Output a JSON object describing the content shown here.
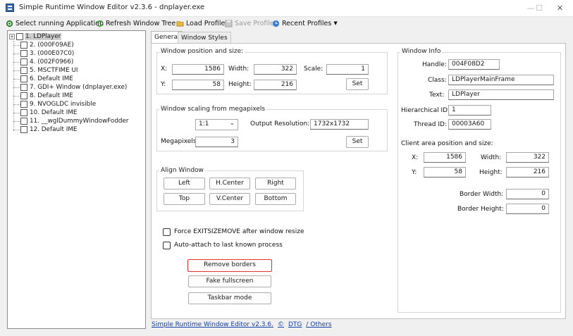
{
  "window": {
    "title": "Simple Runtime Window Editor v2.3.6 - dnplayer.exe",
    "minimize": "—",
    "maximize": "☐",
    "close": "✕"
  },
  "toolbar": {
    "select_app": "Select running Application",
    "refresh": "Refresh Window Tree",
    "load_profile": "Load Profile",
    "save_profile": "Save Profile",
    "recent_profiles": "Recent Profiles"
  },
  "tree": {
    "expander": "+",
    "items": [
      {
        "label": "1. LDPlayer",
        "selected": true
      },
      {
        "label": "2. (000F09AE)"
      },
      {
        "label": "3. (000E07C0)"
      },
      {
        "label": "4. (002F0966)"
      },
      {
        "label": "5. MSCTFIME UI"
      },
      {
        "label": "6. Default IME"
      },
      {
        "label": "7. GDI+ Window (dnplayer.exe)"
      },
      {
        "label": "8. Default IME"
      },
      {
        "label": "9. NVOGLDC invisible"
      },
      {
        "label": "10. Default IME"
      },
      {
        "label": "11. __wglDummyWindowFodder"
      },
      {
        "label": "12. Default IME"
      }
    ]
  },
  "tabs": {
    "general": "General",
    "window_styles": "Window Styles"
  },
  "position": {
    "title": "Window position and size:",
    "x_label": "X:",
    "x_value": "1586",
    "y_label": "Y:",
    "y_value": "58",
    "width_label": "Width:",
    "width_value": "322",
    "height_label": "Height:",
    "height_value": "216",
    "scale_label": "Scale:",
    "scale_value": "1",
    "set_button": "Set"
  },
  "scaling": {
    "title": "Window scaling from megapixels",
    "ratio_value": "1:1",
    "output_label": "Output Resolution:",
    "output_value": "1732x1732",
    "megapixels_label": "Megapixels:",
    "megapixels_value": "3",
    "set_button": "Set"
  },
  "align": {
    "title": "Align Window",
    "left": "Left",
    "hcenter": "H.Center",
    "right": "Right",
    "top": "Top",
    "vcenter": "V.Center",
    "bottom": "Bottom"
  },
  "options": {
    "force_exitsizemove": "Force EXITSIZEMOVE after window resize",
    "auto_attach": "Auto-attach to last known process"
  },
  "actions": {
    "remove_borders": "Remove borders",
    "fake_fullscreen": "Fake fullscreen",
    "taskbar_mode": "Taskbar mode"
  },
  "info": {
    "title": "Window Info",
    "handle_label": "Handle:",
    "handle_value": "004F08D2",
    "class_label": "Class:",
    "class_value": "LDPlayerMainFrame",
    "text_label": "Text:",
    "text_value": "LDPlayer",
    "hier_label": "Hierarchical ID:",
    "hier_value": "1",
    "thread_label": "Thread ID:",
    "thread_value": "00003A60",
    "client_title": "Client area position and size:",
    "cx_label": "X:",
    "cx_value": "1586",
    "cy_label": "Y:",
    "cy_value": "58",
    "cw_label": "Width:",
    "cw_value": "322",
    "ch_label": "Height:",
    "ch_value": "216",
    "bw_label": "Border Width:",
    "bw_value": "0",
    "bh_label": "Border Height:",
    "bh_value": "0"
  },
  "footer": {
    "version_link": "Simple Runtime Window Editor v2.3.6.",
    "copyright_link": "©",
    "dtg_link": "DTG",
    "others_link": "/ Others"
  },
  "colors": {
    "remove_borders_outline": "#e0322a",
    "link": "#1540a8"
  }
}
